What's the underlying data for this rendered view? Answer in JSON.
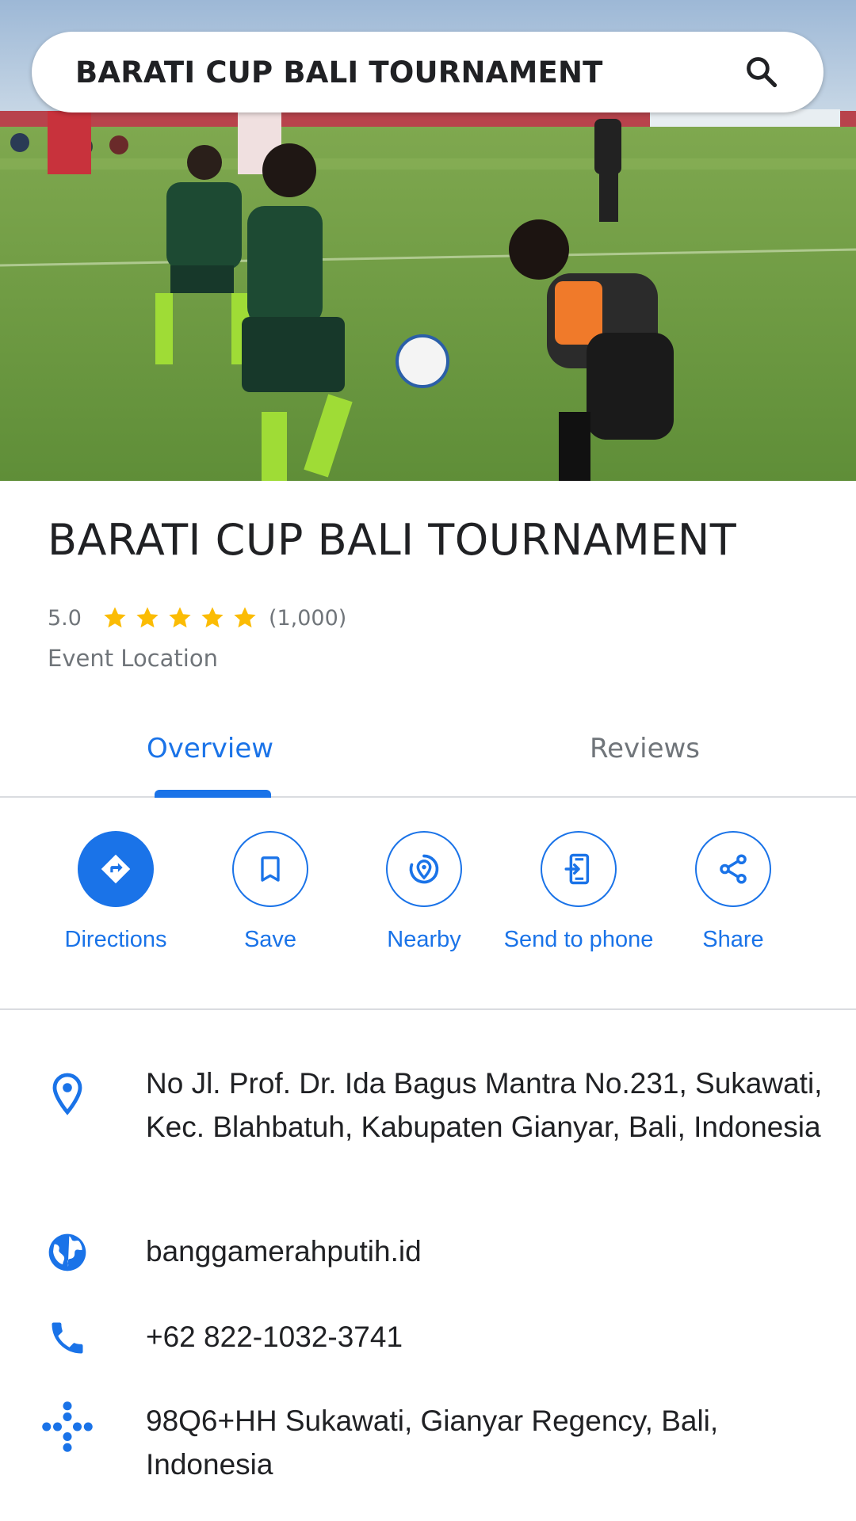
{
  "search": {
    "query": "BARATI CUP BALI TOURNAMENT",
    "icon": "search-icon"
  },
  "hero": {
    "description_icon": "photo"
  },
  "place": {
    "title": "BARATI CUP BALI TOURNAMENT",
    "rating": "5.0",
    "stars": 5,
    "review_count": "(1,000)",
    "category": "Event Location",
    "star_color": "#fbbc04"
  },
  "tabs": [
    {
      "label": "Overview",
      "selected": true
    },
    {
      "label": "Reviews",
      "selected": false
    }
  ],
  "actions": [
    {
      "label": "Directions",
      "icon": "directions-icon"
    },
    {
      "label": "Save",
      "icon": "bookmark-icon"
    },
    {
      "label": "Nearby",
      "icon": "nearby-icon"
    },
    {
      "label": "Send to phone",
      "icon": "send-to-phone-icon"
    },
    {
      "label": "Share",
      "icon": "share-icon"
    }
  ],
  "info": {
    "address": "No Jl. Prof. Dr. Ida Bagus Mantra No.231, Sukawati, Kec. Blahbatuh, Kabupaten Gianyar, Bali, Indonesia",
    "website": "banggamerahputih.id",
    "phone": "+62 822-1032-3741",
    "plus_code": "98Q6+HH Sukawati, Gianyar Regency, Bali, Indonesia"
  },
  "colors": {
    "accent": "#1a73e8",
    "secondary_text": "#70757a",
    "divider": "#dadce0"
  }
}
